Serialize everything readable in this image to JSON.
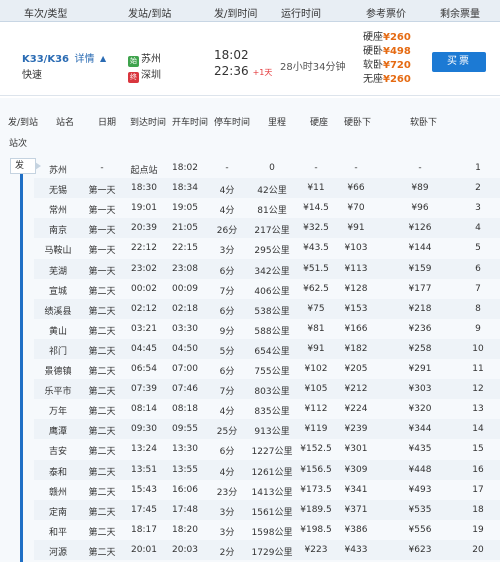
{
  "header": {
    "col_train": "车次/类型",
    "col_stations": "发站/到站",
    "col_times": "发/到时间",
    "col_duration": "运行时间",
    "col_prices": "参考票价",
    "col_remaining": "剩余票量"
  },
  "train": {
    "number": "K33/K36",
    "detail_label": "详情",
    "type": "快速",
    "from_station": "苏州",
    "to_station": "深圳",
    "start_badge": "始",
    "end_badge": "终",
    "depart_time": "18:02",
    "arrive_time": "22:36",
    "plus_day": "+1天",
    "duration": "28小时34分钟",
    "prices": [
      {
        "label": "硬座",
        "value": "¥260"
      },
      {
        "label": "硬卧",
        "value": "¥498"
      },
      {
        "label": "软卧",
        "value": "¥720"
      },
      {
        "label": "无座",
        "value": "¥260"
      }
    ],
    "buy_label": "买票"
  },
  "stops_header": {
    "col_type": "发/到站",
    "col_name": "站名",
    "col_day": "日期",
    "col_arrive": "到达时间",
    "col_depart": "开车时间",
    "col_stop": "停车时间",
    "col_distance": "里程",
    "col_hard_seat": "硬座",
    "col_hard_sleeper": "硬卧下",
    "col_soft_sleeper": "软卧下",
    "sub_label": "站次",
    "depart_tag": "发"
  },
  "stops": [
    {
      "name": "苏州",
      "day": "-",
      "arrive": "起点站",
      "depart": "18:02",
      "stop": "-",
      "distance": "0",
      "hard_seat": "-",
      "hard_sleeper": "-",
      "soft_sleeper": "-",
      "seq": "1"
    },
    {
      "name": "无锡",
      "day": "第一天",
      "arrive": "18:30",
      "depart": "18:34",
      "stop": "4分",
      "distance": "42公里",
      "hard_seat": "¥11",
      "hard_sleeper": "¥66",
      "soft_sleeper": "¥89",
      "seq": "2"
    },
    {
      "name": "常州",
      "day": "第一天",
      "arrive": "19:01",
      "depart": "19:05",
      "stop": "4分",
      "distance": "81公里",
      "hard_seat": "¥14.5",
      "hard_sleeper": "¥70",
      "soft_sleeper": "¥96",
      "seq": "3"
    },
    {
      "name": "南京",
      "day": "第一天",
      "arrive": "20:39",
      "depart": "21:05",
      "stop": "26分",
      "distance": "217公里",
      "hard_seat": "¥32.5",
      "hard_sleeper": "¥91",
      "soft_sleeper": "¥126",
      "seq": "4"
    },
    {
      "name": "马鞍山",
      "day": "第一天",
      "arrive": "22:12",
      "depart": "22:15",
      "stop": "3分",
      "distance": "295公里",
      "hard_seat": "¥43.5",
      "hard_sleeper": "¥103",
      "soft_sleeper": "¥144",
      "seq": "5"
    },
    {
      "name": "芜湖",
      "day": "第一天",
      "arrive": "23:02",
      "depart": "23:08",
      "stop": "6分",
      "distance": "342公里",
      "hard_seat": "¥51.5",
      "hard_sleeper": "¥113",
      "soft_sleeper": "¥159",
      "seq": "6"
    },
    {
      "name": "宣城",
      "day": "第二天",
      "arrive": "00:02",
      "depart": "00:09",
      "stop": "7分",
      "distance": "406公里",
      "hard_seat": "¥62.5",
      "hard_sleeper": "¥128",
      "soft_sleeper": "¥177",
      "seq": "7"
    },
    {
      "name": "绩溪县",
      "day": "第二天",
      "arrive": "02:12",
      "depart": "02:18",
      "stop": "6分",
      "distance": "538公里",
      "hard_seat": "¥75",
      "hard_sleeper": "¥153",
      "soft_sleeper": "¥218",
      "seq": "8"
    },
    {
      "name": "黄山",
      "day": "第二天",
      "arrive": "03:21",
      "depart": "03:30",
      "stop": "9分",
      "distance": "588公里",
      "hard_seat": "¥81",
      "hard_sleeper": "¥166",
      "soft_sleeper": "¥236",
      "seq": "9"
    },
    {
      "name": "祁门",
      "day": "第二天",
      "arrive": "04:45",
      "depart": "04:50",
      "stop": "5分",
      "distance": "654公里",
      "hard_seat": "¥91",
      "hard_sleeper": "¥182",
      "soft_sleeper": "¥258",
      "seq": "10"
    },
    {
      "name": "景德镇",
      "day": "第二天",
      "arrive": "06:54",
      "depart": "07:00",
      "stop": "6分",
      "distance": "755公里",
      "hard_seat": "¥102",
      "hard_sleeper": "¥205",
      "soft_sleeper": "¥291",
      "seq": "11"
    },
    {
      "name": "乐平市",
      "day": "第二天",
      "arrive": "07:39",
      "depart": "07:46",
      "stop": "7分",
      "distance": "803公里",
      "hard_seat": "¥105",
      "hard_sleeper": "¥212",
      "soft_sleeper": "¥303",
      "seq": "12"
    },
    {
      "name": "万年",
      "day": "第二天",
      "arrive": "08:14",
      "depart": "08:18",
      "stop": "4分",
      "distance": "835公里",
      "hard_seat": "¥112",
      "hard_sleeper": "¥224",
      "soft_sleeper": "¥320",
      "seq": "13"
    },
    {
      "name": "鹰潭",
      "day": "第二天",
      "arrive": "09:30",
      "depart": "09:55",
      "stop": "25分",
      "distance": "913公里",
      "hard_seat": "¥119",
      "hard_sleeper": "¥239",
      "soft_sleeper": "¥344",
      "seq": "14"
    },
    {
      "name": "吉安",
      "day": "第二天",
      "arrive": "13:24",
      "depart": "13:30",
      "stop": "6分",
      "distance": "1227公里",
      "hard_seat": "¥152.5",
      "hard_sleeper": "¥301",
      "soft_sleeper": "¥435",
      "seq": "15"
    },
    {
      "name": "泰和",
      "day": "第二天",
      "arrive": "13:51",
      "depart": "13:55",
      "stop": "4分",
      "distance": "1261公里",
      "hard_seat": "¥156.5",
      "hard_sleeper": "¥309",
      "soft_sleeper": "¥448",
      "seq": "16"
    },
    {
      "name": "赣州",
      "day": "第二天",
      "arrive": "15:43",
      "depart": "16:06",
      "stop": "23分",
      "distance": "1413公里",
      "hard_seat": "¥173.5",
      "hard_sleeper": "¥341",
      "soft_sleeper": "¥493",
      "seq": "17"
    },
    {
      "name": "定南",
      "day": "第二天",
      "arrive": "17:45",
      "depart": "17:48",
      "stop": "3分",
      "distance": "1561公里",
      "hard_seat": "¥189.5",
      "hard_sleeper": "¥371",
      "soft_sleeper": "¥535",
      "seq": "18"
    },
    {
      "name": "和平",
      "day": "第二天",
      "arrive": "18:17",
      "depart": "18:20",
      "stop": "3分",
      "distance": "1598公里",
      "hard_seat": "¥198.5",
      "hard_sleeper": "¥386",
      "soft_sleeper": "¥556",
      "seq": "19"
    },
    {
      "name": "河源",
      "day": "第二天",
      "arrive": "20:01",
      "depart": "20:03",
      "stop": "2分",
      "distance": "1729公里",
      "hard_seat": "¥223",
      "hard_sleeper": "¥433",
      "soft_sleeper": "¥623",
      "seq": "20"
    }
  ],
  "colors": {
    "link_blue": "#2a6bb3",
    "price_orange": "#e56a12",
    "buy_button": "#1c7ad4",
    "rail_blue": "#1f6fc5",
    "plus_day_red": "#e4393c"
  }
}
